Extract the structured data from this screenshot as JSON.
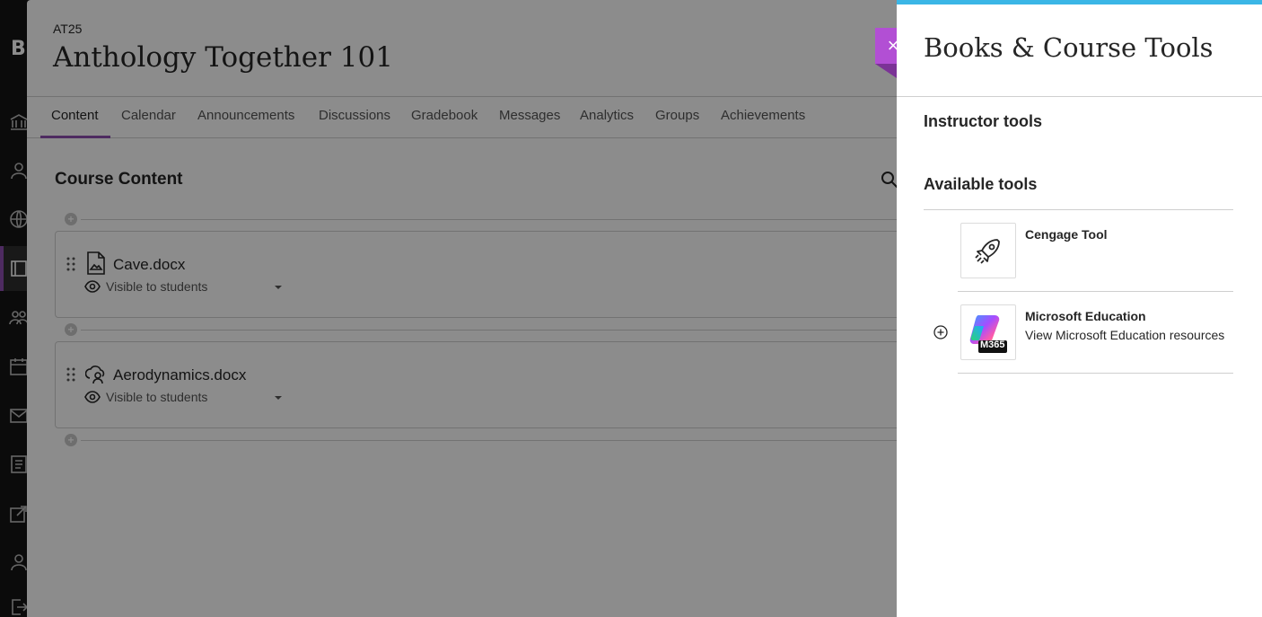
{
  "leftnav": {
    "logo": "B",
    "icons": [
      "institution-icon",
      "profile-icon",
      "globe-icon",
      "courses-icon",
      "groups-icon",
      "calendar-icon",
      "messages-icon",
      "grades-icon",
      "tools-icon",
      "user-icon",
      "logout-icon"
    ]
  },
  "course": {
    "code": "AT25",
    "title": "Anthology Together 101",
    "tabs": [
      {
        "label": "Content"
      },
      {
        "label": "Calendar"
      },
      {
        "label": "Announcements"
      },
      {
        "label": "Discussions"
      },
      {
        "label": "Gradebook"
      },
      {
        "label": "Messages"
      },
      {
        "label": "Analytics"
      },
      {
        "label": "Groups"
      },
      {
        "label": "Achievements"
      }
    ],
    "content_title": "Course Content",
    "items": [
      {
        "name": "Cave.docx",
        "visibility": "Visible to students"
      },
      {
        "name": "Aerodynamics.docx",
        "visibility": "Visible to students"
      }
    ]
  },
  "panel": {
    "title": "Books & Course Tools",
    "instructor_tools": "Instructor tools",
    "available_tools": "Available tools",
    "tools": [
      {
        "name": "Cengage Tool",
        "description": "",
        "icon": "rocket-icon"
      },
      {
        "name": "Microsoft Education",
        "description": "View Microsoft Education resources",
        "icon": "m365-icon",
        "thumb_label": "M365"
      }
    ],
    "close_label": "×"
  },
  "colors": {
    "accent_purple": "#8e4fb1",
    "close_purple": "#b24fd4",
    "top_bar_blue": "#3bb6e6"
  }
}
